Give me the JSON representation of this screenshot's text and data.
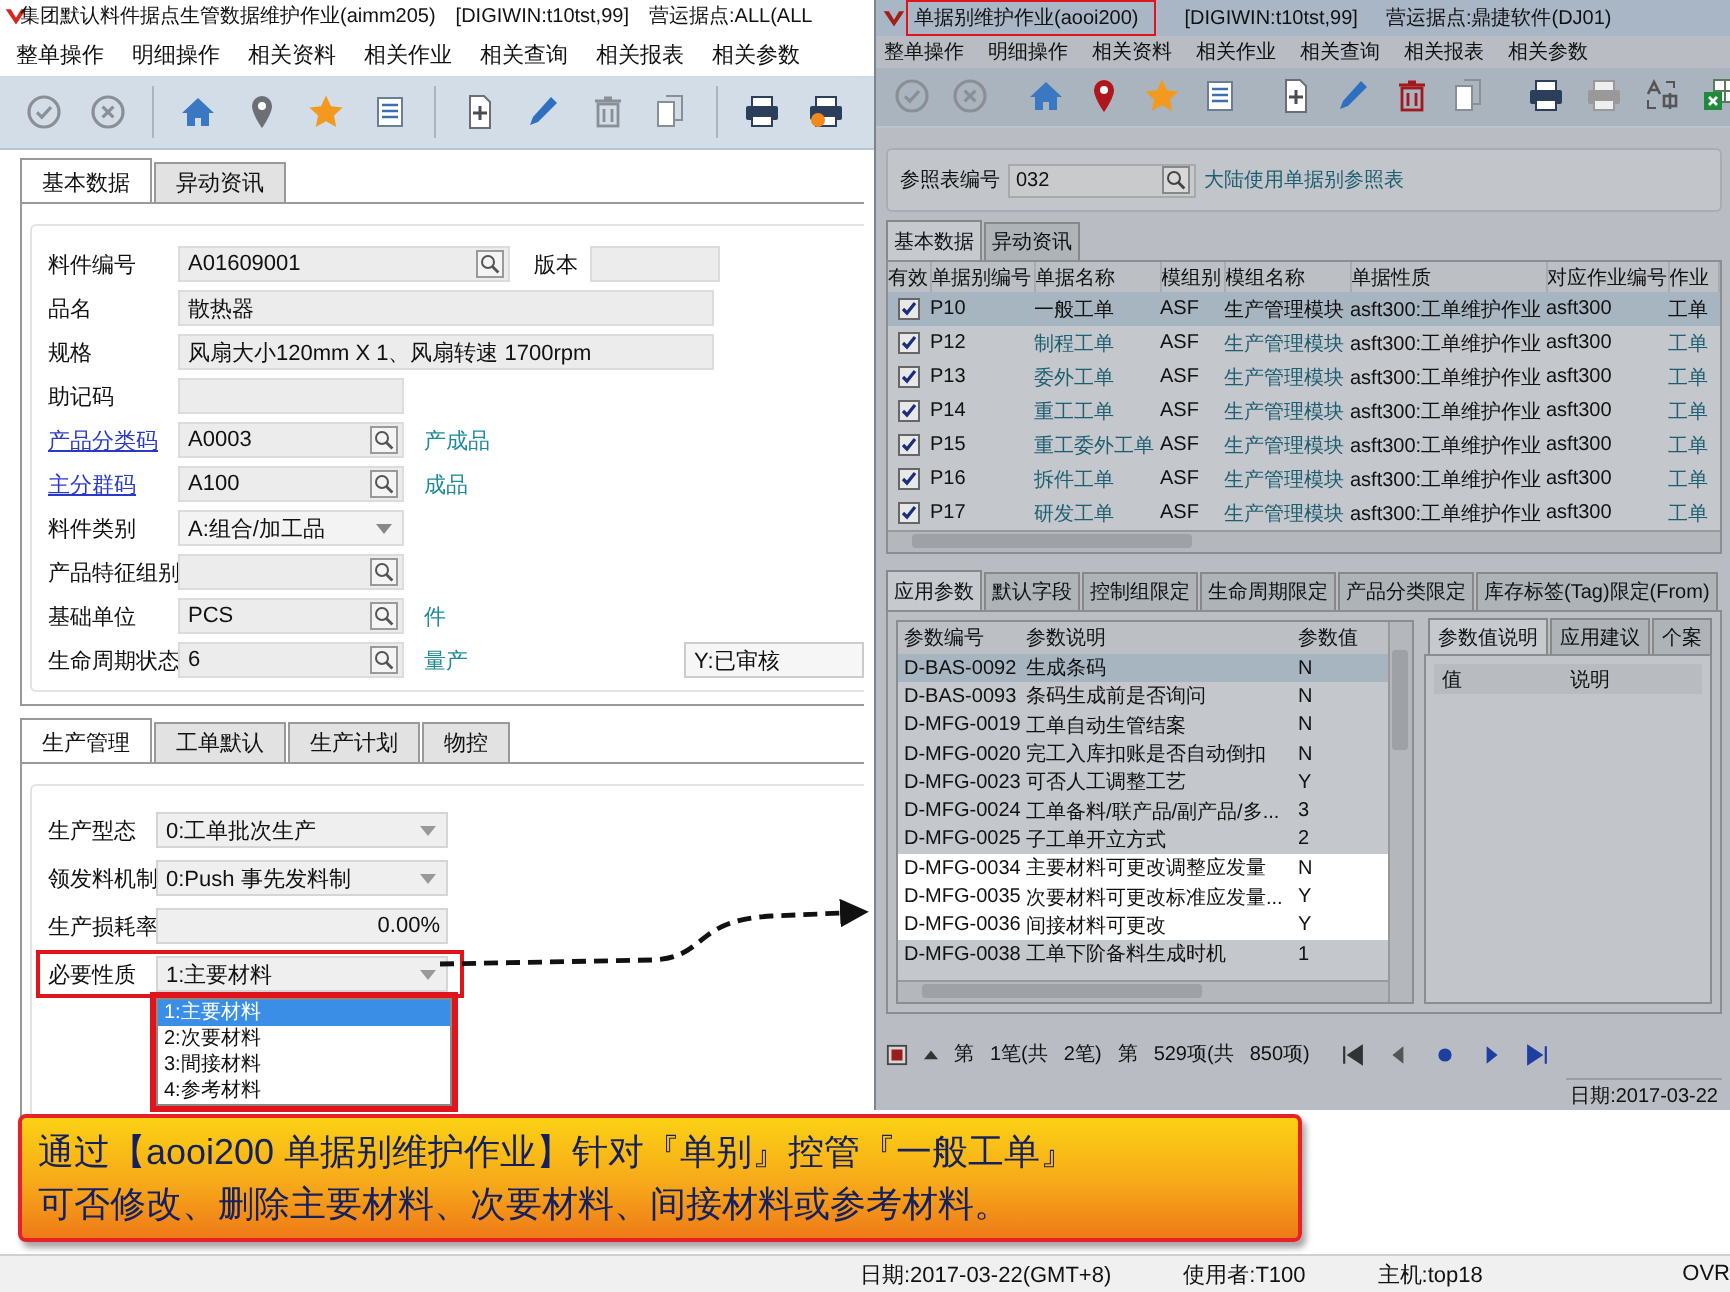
{
  "left_window": {
    "title": "集团默认料件据点生管数据维护作业(aimm205)",
    "server": "[DIGIWIN:t10tst,99]",
    "site": "营运据点:ALL(ALL",
    "menu": [
      "整单操作",
      "明细操作",
      "相关资料",
      "相关作业",
      "相关查询",
      "相关报表",
      "相关参数"
    ],
    "tabs": [
      {
        "label": "基本数据",
        "selected": true
      },
      {
        "label": "异动资讯",
        "selected": false
      }
    ],
    "fields": [
      {
        "kind": "lookup",
        "label": "料件编号",
        "link": false,
        "value": "A01609001",
        "side_label": "版本"
      },
      {
        "kind": "text",
        "label": "品名",
        "link": false,
        "value": "散热器"
      },
      {
        "kind": "text",
        "label": "规格",
        "link": false,
        "value": "风扇大小120mm X 1、风扇转速 1700rpm"
      },
      {
        "kind": "text",
        "label": "助记码",
        "link": false
      },
      {
        "kind": "lookup",
        "label": "产品分类码",
        "link": true,
        "value": "A0003",
        "desc": "产成品"
      },
      {
        "kind": "lookup",
        "label": "主分群码",
        "link": true,
        "value": "A100",
        "desc": "成品"
      },
      {
        "kind": "select",
        "label": "料件类别",
        "link": false,
        "value": "A:组合/加工品"
      },
      {
        "kind": "lookup",
        "label": "产品特征组别",
        "link": false
      },
      {
        "kind": "lookup",
        "label": "基础单位",
        "link": false,
        "value": "PCS",
        "desc": "件"
      },
      {
        "kind": "lookup",
        "label": "生命周期状态",
        "link": false,
        "value": "6",
        "desc": "量产",
        "side_value": "Y:已审核"
      }
    ],
    "sub_tabs": [
      {
        "label": "生产管理",
        "selected": true
      },
      {
        "label": "工单默认",
        "selected": false
      },
      {
        "label": "生产计划",
        "selected": false
      },
      {
        "label": "物控",
        "selected": false
      }
    ],
    "prod_fields": [
      {
        "kind": "select",
        "label": "生产型态",
        "value": "0:工单批次生产",
        "highlighted": false
      },
      {
        "kind": "select",
        "label": "领发料机制",
        "value": "0:Push 事先发料制",
        "highlighted": false
      },
      {
        "kind": "number",
        "label": "生产损耗率",
        "value": "0.00%",
        "highlighted": false
      },
      {
        "kind": "select",
        "label": "必要性质",
        "value": "1:主要材料",
        "highlighted": true,
        "expanded": true,
        "options": [
          {
            "label": "1:主要材料",
            "selected": true
          },
          {
            "label": "2:次要材料",
            "selected": false
          },
          {
            "label": "3:間接材料",
            "selected": false
          },
          {
            "label": "4:参考材料",
            "selected": false
          }
        ]
      }
    ]
  },
  "right_window": {
    "title": "单据别维护作业(aooi200)",
    "server": "[DIGIWIN:t10tst,99]",
    "site": "营运据点:鼎捷软件(DJ01)",
    "menu": [
      "整单操作",
      "明细操作",
      "相关资料",
      "相关作业",
      "相关查询",
      "相关报表",
      "相关参数"
    ],
    "ref_label": "参照表编号",
    "ref_value": "032",
    "ref_desc": "大陆使用单据别参照表",
    "tabs": [
      {
        "label": "基本数据",
        "selected": true
      },
      {
        "label": "异动资讯",
        "selected": false
      }
    ],
    "table": {
      "check_column": "有效",
      "columns": [
        "单据别编号",
        "单据名称",
        "模组别",
        "模组名称",
        "单据性质",
        "对应作业编号",
        "作业"
      ],
      "rows": [
        {
          "valid": true,
          "selected": true,
          "cells": [
            "P10",
            "一般工单",
            "ASF",
            "生产管理模块",
            "asft300:工单维护作业",
            "asft300",
            "工单"
          ]
        },
        {
          "valid": true,
          "selected": false,
          "cells": [
            "P12",
            "制程工单",
            "ASF",
            "生产管理模块",
            "asft300:工单维护作业",
            "asft300",
            "工单"
          ]
        },
        {
          "valid": true,
          "selected": false,
          "cells": [
            "P13",
            "委外工单",
            "ASF",
            "生产管理模块",
            "asft300:工单维护作业",
            "asft300",
            "工单"
          ]
        },
        {
          "valid": true,
          "selected": false,
          "cells": [
            "P14",
            "重工工单",
            "ASF",
            "生产管理模块",
            "asft300:工单维护作业",
            "asft300",
            "工单"
          ]
        },
        {
          "valid": true,
          "selected": false,
          "cells": [
            "P15",
            "重工委外工单",
            "ASF",
            "生产管理模块",
            "asft300:工单维护作业",
            "asft300",
            "工单"
          ]
        },
        {
          "valid": true,
          "selected": false,
          "cells": [
            "P16",
            "拆件工单",
            "ASF",
            "生产管理模块",
            "asft300:工单维护作业",
            "asft300",
            "工单"
          ]
        },
        {
          "valid": true,
          "selected": false,
          "cells": [
            "P17",
            "研发工单",
            "ASF",
            "生产管理模块",
            "asft300:工单维护作业",
            "asft300",
            "工单"
          ]
        }
      ]
    },
    "param_tabs": [
      {
        "label": "应用参数",
        "selected": true
      },
      {
        "label": "默认字段",
        "selected": false
      },
      {
        "label": "控制组限定",
        "selected": false
      },
      {
        "label": "生命周期限定",
        "selected": false
      },
      {
        "label": "产品分类限定",
        "selected": false
      },
      {
        "label": "库存标签(Tag)限定(From)",
        "selected": false
      }
    ],
    "param_table": {
      "columns": [
        "参数编号",
        "参数说明",
        "参数值"
      ],
      "rows": [
        {
          "cells": [
            "D-BAS-0092",
            "生成条码",
            "N"
          ],
          "selected": true,
          "highlighted": false
        },
        {
          "cells": [
            "D-BAS-0093",
            "条码生成前是否询问",
            "N"
          ],
          "selected": false,
          "highlighted": false
        },
        {
          "cells": [
            "D-MFG-0019",
            "工单自动生管结案",
            "N"
          ],
          "selected": false,
          "highlighted": false
        },
        {
          "cells": [
            "D-MFG-0020",
            "完工入库扣账是否自动倒扣",
            "N"
          ],
          "selected": false,
          "highlighted": false
        },
        {
          "cells": [
            "D-MFG-0023",
            "可否人工调整工艺",
            "Y"
          ],
          "selected": false,
          "highlighted": false
        },
        {
          "cells": [
            "D-MFG-0024",
            "工单备料/联产品/副产品/多...",
            "3"
          ],
          "selected": false,
          "highlighted": false
        },
        {
          "cells": [
            "D-MFG-0025",
            "子工单开立方式",
            "2"
          ],
          "selected": false,
          "highlighted": false
        },
        {
          "cells": [
            "D-MFG-0034",
            "主要材料可更改调整应发量",
            "N"
          ],
          "selected": false,
          "highlighted": true
        },
        {
          "cells": [
            "D-MFG-0035",
            "次要材料可更改标准应发量...",
            "Y"
          ],
          "selected": false,
          "highlighted": true
        },
        {
          "cells": [
            "D-MFG-0036",
            "间接材料可更改",
            "Y"
          ],
          "selected": false,
          "highlighted": true
        },
        {
          "cells": [
            "D-MFG-0038",
            "工单下阶备料生成时机",
            "1"
          ],
          "selected": false,
          "highlighted": false
        }
      ]
    },
    "detail_tabs": [
      {
        "label": "参数值说明",
        "selected": true
      },
      {
        "label": "应用建议",
        "selected": false
      },
      {
        "label": "个案",
        "selected": false
      }
    ],
    "detail_columns": [
      "值",
      "说明"
    ],
    "pager": [
      "第",
      "1笔(共",
      "2笔)",
      "第",
      "529项(共",
      "850项)"
    ],
    "status": "日期:2017-03-22"
  },
  "callout": [
    "通过【aooi200 单据别维护作业】针对『单别』控管『一般工单』",
    "可否修改、删除主要材料、次要材料、间接材料或参考材料。"
  ],
  "status_bar": {
    "date": "日期:2017-03-22(GMT+8)",
    "user": "使用者:T100",
    "host": "主机:top18",
    "mode": "OVR"
  }
}
